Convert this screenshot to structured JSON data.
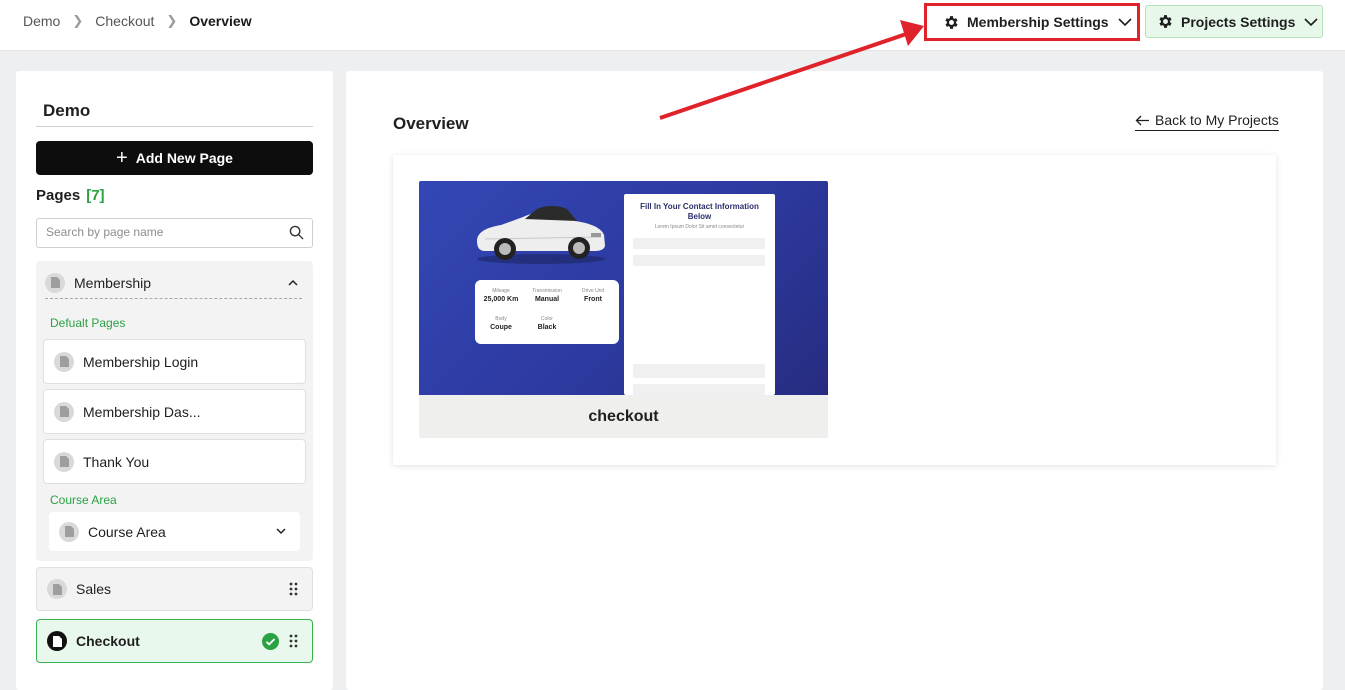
{
  "breadcrumb": [
    "Demo",
    "Checkout",
    "Overview"
  ],
  "header": {
    "membership_settings": "Membership Settings",
    "projects_settings": "Projects Settings"
  },
  "sidebar": {
    "project_name": "Demo",
    "add_page": "Add New Page",
    "pages_label": "Pages",
    "pages_count": "[7]",
    "search_placeholder": "Search by page name",
    "membership_group": {
      "name": "Membership",
      "default_label": "Defualt Pages",
      "default_pages": [
        "Membership Login",
        "Membership Das...",
        "Thank You"
      ],
      "course_label": "Course Area",
      "course_select": "Course Area"
    },
    "other_pages": [
      "Sales",
      "Checkout"
    ]
  },
  "main": {
    "title": "Overview",
    "back_link": "Back to My Projects",
    "card": {
      "caption": "checkout",
      "form_title": "Fill In Your Contact Information Below",
      "form_sub": "Lorem Ipsum Dolor Sit amet consectetur",
      "specs": [
        {
          "k": "Mileage",
          "v": "25,000 Km"
        },
        {
          "k": "Transmission",
          "v": "Manual"
        },
        {
          "k": "Drive Unit",
          "v": "Front"
        },
        {
          "k": "Body",
          "v": "Coupe"
        },
        {
          "k": "Color",
          "v": "Black"
        }
      ]
    }
  },
  "colors": {
    "accent_green": "#2aa142",
    "highlight_red": "#e0232a",
    "thumb_blue": "#2d3aa0"
  },
  "icons": [
    "gear-icon",
    "chevron-down-icon",
    "plus-icon",
    "search-icon",
    "document-icon",
    "chevron-up-icon",
    "drag-handle-icon",
    "check-circle-icon",
    "arrow-left-icon"
  ]
}
